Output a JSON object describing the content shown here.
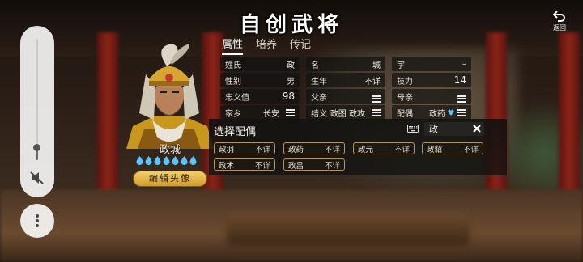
{
  "title": "自创武将",
  "back": {
    "label": "返回"
  },
  "tabs": [
    {
      "label": "属性",
      "active": true
    },
    {
      "label": "培养",
      "active": false
    },
    {
      "label": "传记",
      "active": false
    }
  ],
  "fields": {
    "surname": {
      "label": "姓氏",
      "value": "政"
    },
    "given_name": {
      "label": "名",
      "value": "城"
    },
    "courtesy": {
      "label": "字",
      "value": "–"
    },
    "gender": {
      "label": "性别",
      "value": "男"
    },
    "birth_year": {
      "label": "生年",
      "value": "不详"
    },
    "skill": {
      "label": "技力",
      "value": "14"
    },
    "loyalty": {
      "label": "忠义值",
      "value": "98"
    },
    "father": {
      "label": "父亲"
    },
    "mother": {
      "label": "母亲"
    },
    "hometown": {
      "label": "家乡",
      "value": "长安"
    },
    "sworn": {
      "label": "结义",
      "value": "政图 政攻"
    },
    "spouse": {
      "label": "配偶",
      "value": "政药"
    }
  },
  "character": {
    "name": "政城",
    "drop_count": 7,
    "edit_label": "编辑头像"
  },
  "spouse_panel": {
    "title": "选择配偶",
    "search_value": "政",
    "options": [
      {
        "name": "政羽",
        "status": "不详"
      },
      {
        "name": "政药",
        "status": "不详"
      },
      {
        "name": "政元",
        "status": "不详"
      },
      {
        "name": "政貂",
        "status": "不详"
      },
      {
        "name": "政术",
        "status": "不详"
      },
      {
        "name": "政吕",
        "status": "不详"
      }
    ]
  },
  "colors": {
    "accent_gold": "#d29b2d",
    "drop_blue": "#5cc4ff"
  },
  "icons": [
    "mute-icon",
    "more-icon",
    "back-icon",
    "keyboard-icon",
    "close-icon",
    "menu-icon",
    "water-drop-icon"
  ]
}
